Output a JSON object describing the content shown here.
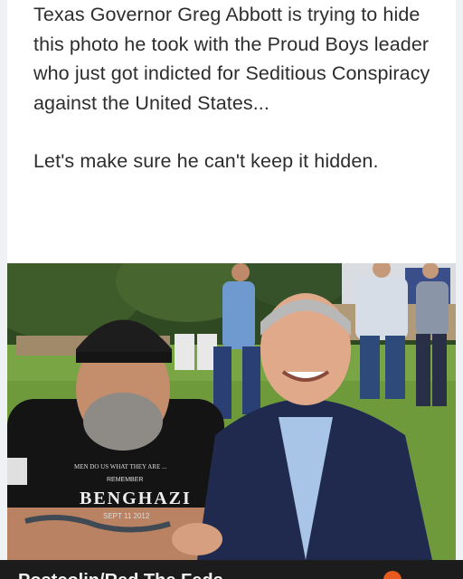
{
  "post": {
    "paragraph1": "Texas Governor Greg Abbott is trying to hide this photo he took with the Proud Boys leader who just got indicted for Seditious Conspiracy against the United States...",
    "paragraph2": "Let's make sure he can't keep it hidden."
  },
  "photo": {
    "shirt_top_text": "MEN DO US WHAT THEY ARE ...",
    "shirt_remember": "REMEMBER",
    "shirt_main": "BENGHAZI",
    "shirt_date": "SEPT 11 2012",
    "description_icon": "photo-of-two-men"
  },
  "bottom_bar": {
    "title": "Postcolin/Red The Feds",
    "extra": "..."
  },
  "colors": {
    "text": "#2d2d2d",
    "bar": "#1c1c1c",
    "accent": "#e85a1e"
  }
}
